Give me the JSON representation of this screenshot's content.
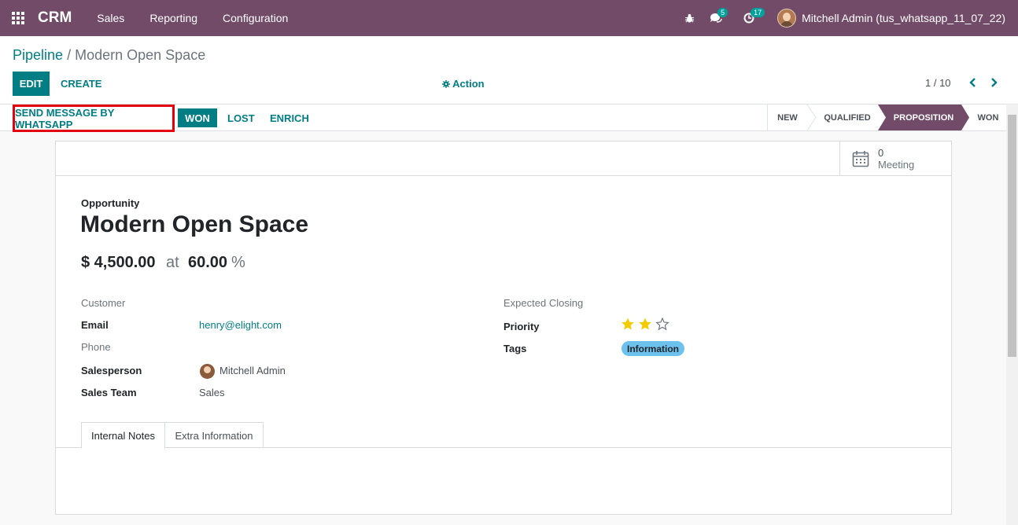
{
  "navbar": {
    "brand": "CRM",
    "menus": [
      "Sales",
      "Reporting",
      "Configuration"
    ],
    "messages_count": "5",
    "activities_count": "17",
    "user_name": "Mitchell Admin (tus_whatsapp_11_07_22)"
  },
  "breadcrumb": {
    "parent": "Pipeline",
    "separator": "/",
    "current": "Modern Open Space"
  },
  "toolbar": {
    "edit_label": "EDIT",
    "create_label": "CREATE",
    "action_label": "Action",
    "pager": "1 / 10"
  },
  "statusbar": {
    "whatsapp_label": "SEND MESSAGE BY WHATSAPP",
    "won_label": "WON",
    "lost_label": "LOST",
    "enrich_label": "ENRICH",
    "stages": [
      "NEW",
      "QUALIFIED",
      "PROPOSITION",
      "WON"
    ],
    "active_stage": "PROPOSITION"
  },
  "button_box": {
    "meeting_count": "0",
    "meeting_label": "Meeting"
  },
  "form": {
    "type_label": "Opportunity",
    "title": "Modern Open Space",
    "revenue": "$ 4,500.00",
    "at_label": "at",
    "probability": "60.00",
    "percent_sign": "%",
    "left_fields": {
      "customer_label": "Customer",
      "email_label": "Email",
      "email_value": "henry@elight.com",
      "phone_label": "Phone",
      "salesperson_label": "Salesperson",
      "salesperson_value": "Mitchell Admin",
      "sales_team_label": "Sales Team",
      "sales_team_value": "Sales"
    },
    "right_fields": {
      "expected_closing_label": "Expected Closing",
      "priority_label": "Priority",
      "priority_stars": 2,
      "priority_max": 3,
      "tags_label": "Tags",
      "tag_value": "Information"
    }
  },
  "tabs": [
    "Internal Notes",
    "Extra Information"
  ],
  "colors": {
    "navbar": "#714b67",
    "accent": "#017e84",
    "highlight_border": "#e3000f",
    "star_filled": "#f3cc00",
    "tag": "#6cc1ed"
  }
}
